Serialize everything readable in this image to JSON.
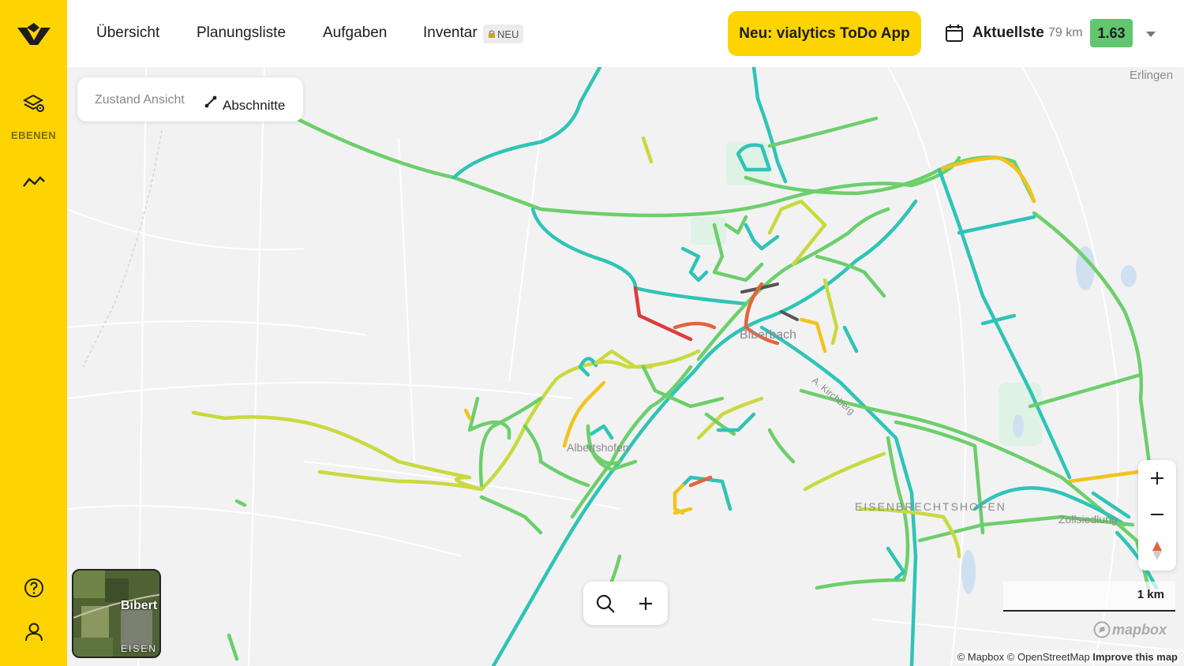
{
  "sidebar": {
    "layers_label": "EBENEN",
    "icons": [
      "logo-icon",
      "layers-gear-icon",
      "trend-line-icon",
      "help-icon",
      "user-icon"
    ]
  },
  "nav": {
    "items": [
      "Übersicht",
      "Planungsliste",
      "Aufgaben",
      "Inventar"
    ],
    "inventar_badge": "NEU",
    "todo_button": "Neu: vialytics ToDo App",
    "latest_label": "Aktuellste",
    "km": "79 km",
    "score": "1.63",
    "colors": {
      "accent": "#fdd400",
      "score": "#61c66f"
    }
  },
  "map_view": {
    "title": "Zustand Ansicht",
    "segment_label": "Abschnitte",
    "places": [
      "Erlingen",
      "Biberbach",
      "Albertshofen",
      "EISENBRECHTSHOFEN",
      "Zollsiedlung",
      "A. Kirchberg"
    ],
    "minimap": {
      "label1": "Bibert",
      "label2": "EISEN"
    },
    "scale_label": "1 km",
    "mapbox_logo": "mapbox",
    "attribution": {
      "mapbox": "© Mapbox",
      "osm": "© OpenStreetMap",
      "improve": "Improve this map"
    },
    "condition_colors": {
      "good": "#2ec4b6",
      "ok": "#6ccf6a",
      "fair": "#c9d93f",
      "poor": "#f0c41b",
      "bad": "#e6633a",
      "very_bad": "#e03a3a"
    }
  }
}
